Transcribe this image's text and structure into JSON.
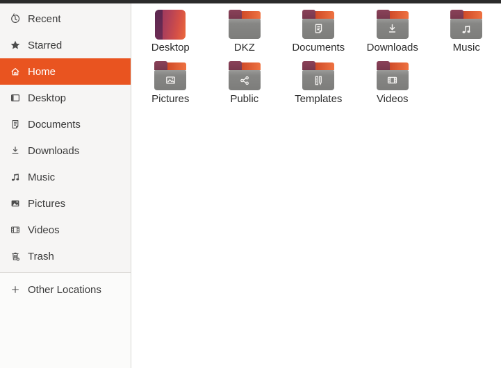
{
  "window": {
    "app": "files-manager",
    "topbar_color": "#2b2b2b",
    "accent_color": "#E95420"
  },
  "sidebar": {
    "items": [
      {
        "label": "Recent",
        "icon": "recent-icon",
        "selected": false
      },
      {
        "label": "Starred",
        "icon": "starred-icon",
        "selected": false
      },
      {
        "label": "Home",
        "icon": "home-icon",
        "selected": true
      },
      {
        "label": "Desktop",
        "icon": "desktop-icon",
        "selected": false
      },
      {
        "label": "Documents",
        "icon": "documents-icon",
        "selected": false
      },
      {
        "label": "Downloads",
        "icon": "downloads-icon",
        "selected": false
      },
      {
        "label": "Music",
        "icon": "music-icon",
        "selected": false
      },
      {
        "label": "Pictures",
        "icon": "pictures-icon",
        "selected": false
      },
      {
        "label": "Videos",
        "icon": "videos-icon",
        "selected": false
      },
      {
        "label": "Trash",
        "icon": "trash-icon",
        "selected": false
      }
    ],
    "other_locations": {
      "label": "Other Locations",
      "icon": "plus-icon"
    }
  },
  "files": {
    "items": [
      {
        "name": "Desktop",
        "icon": "desktop-gradient-icon"
      },
      {
        "name": "DKZ",
        "icon": "folder-icon"
      },
      {
        "name": "Documents",
        "icon": "folder-documents-icon"
      },
      {
        "name": "Downloads",
        "icon": "folder-downloads-icon"
      },
      {
        "name": "Music",
        "icon": "folder-music-icon"
      },
      {
        "name": "Pictures",
        "icon": "folder-pictures-icon"
      },
      {
        "name": "Public",
        "icon": "folder-public-icon"
      },
      {
        "name": "Templates",
        "icon": "folder-templates-icon"
      },
      {
        "name": "Videos",
        "icon": "folder-videos-icon"
      }
    ],
    "folder_colors": {
      "body": "#868684",
      "tab": "#7d3a4f",
      "band": "#e06536"
    }
  }
}
